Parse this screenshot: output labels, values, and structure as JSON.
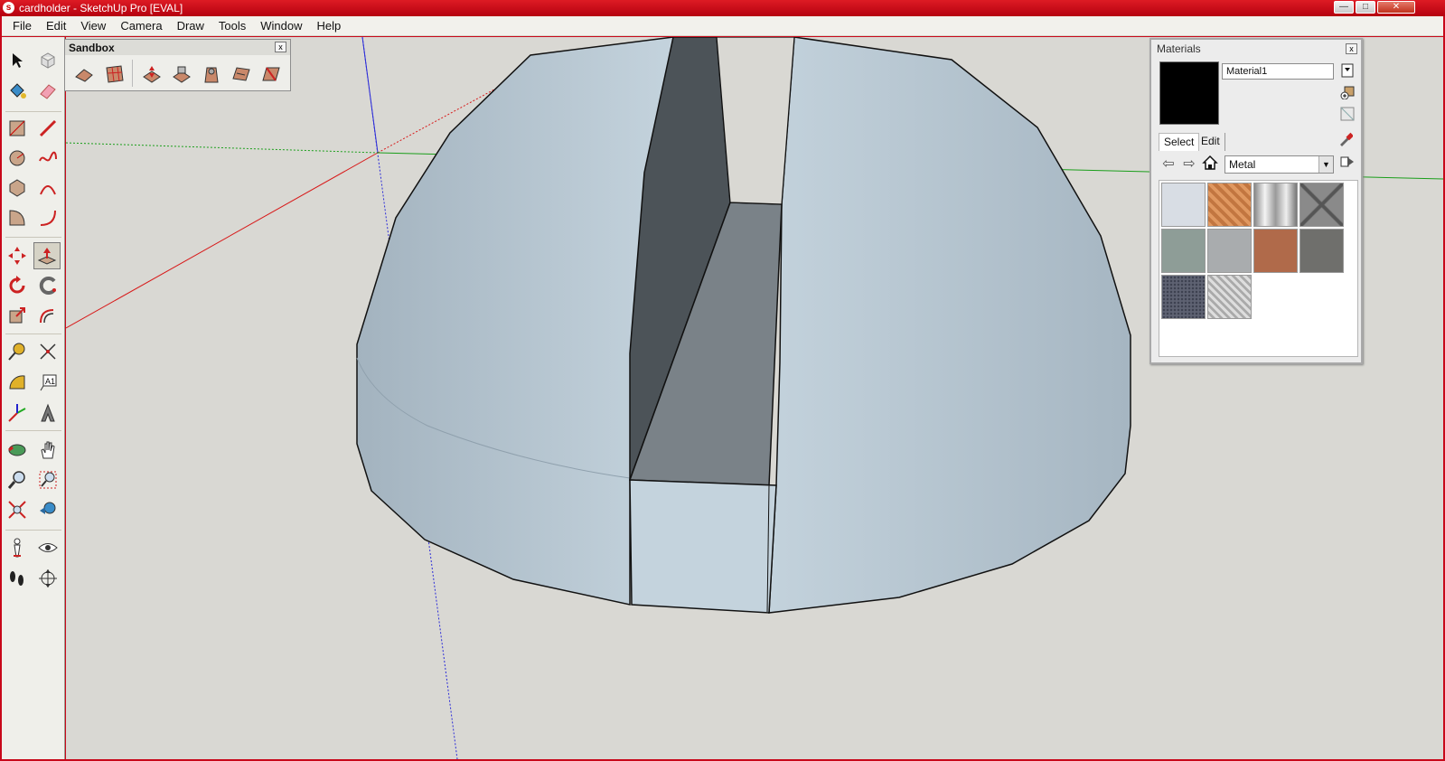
{
  "window": {
    "title": "cardholder - SketchUp Pro [EVAL]",
    "buttons": [
      "—",
      "□",
      "✕"
    ]
  },
  "menu": [
    "File",
    "Edit",
    "View",
    "Camera",
    "Draw",
    "Tools",
    "Window",
    "Help"
  ],
  "toolbar": {
    "tools": [
      "select-tool",
      "component-tool",
      "paint-bucket-tool",
      "eraser-tool",
      "rectangle-tool",
      "pencil-line-tool",
      "circle-tool",
      "freehand-tool",
      "polygon-tool",
      "arc-tool",
      "pie-tool",
      "two-point-arc-tool",
      "move-tool",
      "push-pull-tool",
      "rotate-tool",
      "follow-me-tool",
      "scale-tool",
      "offset-tool",
      "tape-measure-tool",
      "dimension-tool",
      "protractor-tool",
      "text-tool",
      "axes-tool",
      "3d-text-tool",
      "orbit-tool",
      "pan-tool",
      "zoom-tool",
      "zoom-window-tool",
      "zoom-extents-tool",
      "previous-view-tool",
      "position-camera-tool",
      "look-around-tool",
      "walk-tool",
      "section-plane-tool"
    ],
    "active_tool": "push-pull-tool"
  },
  "sandbox": {
    "title": "Sandbox",
    "close": "x",
    "tools": [
      "from-contours-icon",
      "from-scratch-icon",
      "smoove-icon",
      "stamp-icon",
      "drape-icon",
      "add-detail-icon",
      "flip-edge-icon"
    ]
  },
  "materials": {
    "title": "Materials",
    "close": "x",
    "current_name": "Material1",
    "current_color": "#000000",
    "tabs": [
      "Select",
      "Edit"
    ],
    "active_tab": "Select",
    "library": "Metal",
    "thumbnails": [
      {
        "name": "metal-light-gray-texture",
        "color": "#d8dde4"
      },
      {
        "name": "metal-copper-pattern",
        "color": "#d4884e"
      },
      {
        "name": "metal-brushed-chrome",
        "color": "#c8c8c8"
      },
      {
        "name": "metal-grate-x",
        "color": "#8a8a8a"
      },
      {
        "name": "metal-green-gray",
        "color": "#8e9d97"
      },
      {
        "name": "metal-gray-speckle",
        "color": "#a9acae"
      },
      {
        "name": "metal-rusty-copper",
        "color": "#b06a4a"
      },
      {
        "name": "metal-dark-gray",
        "color": "#6f6f6c"
      },
      {
        "name": "metal-blue-gray-dots",
        "color": "#5e6272"
      },
      {
        "name": "metal-diamond-plate",
        "color": "#c3c3c3"
      }
    ]
  },
  "scene": {
    "background": "#d9d8d3",
    "surface_color": "#b2c3cf",
    "slot_dark": "#4c5358",
    "slot_mid": "#7a8288"
  }
}
